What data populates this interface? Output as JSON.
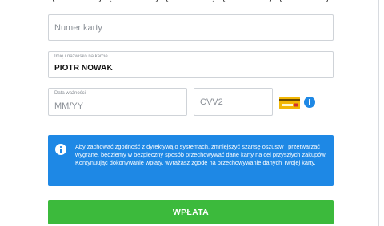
{
  "form": {
    "card_number": {
      "placeholder": "Numer karty",
      "value": ""
    },
    "cardholder": {
      "label": "Imię i nazwisko na karcie",
      "value": "PIOTR NOWAK"
    },
    "expiry": {
      "label": "Data ważności",
      "placeholder": "MM/YY"
    },
    "cvv": {
      "placeholder": "CVV2"
    },
    "cvv_help_icon": "cvv-card-icon",
    "info_icon": "info-icon"
  },
  "notice": {
    "icon": "info-icon",
    "text": "Aby zachować zgodność z dyrektywą o systemach, zmniejszyć szansę oszustw i przetwarzać wygrane, będziemy w bezpieczny sposób przechowywać dane karty na cel przyszłych zakupów. Kontynuując dokonywanie wpłaty, wyrażasz zgodę na przechowywanie danych Twojej karty."
  },
  "submit": {
    "label": "WPŁATA"
  },
  "colors": {
    "primary_blue": "#1e88e5",
    "submit_green": "#3cba3c",
    "card_icon": "#f2b705"
  }
}
